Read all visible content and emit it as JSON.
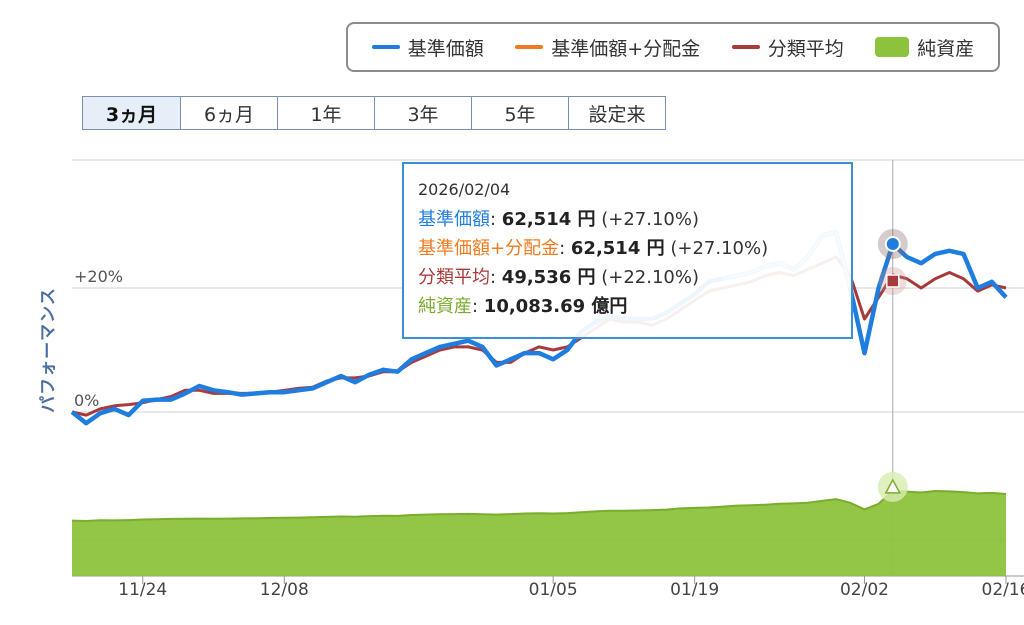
{
  "legend": {
    "items": [
      {
        "label": "基準価額",
        "color": "#1f7de0",
        "kind": "line"
      },
      {
        "label": "基準価額+分配金",
        "color": "#f07a1f",
        "kind": "line"
      },
      {
        "label": "分類平均",
        "color": "#a83a3a",
        "kind": "line"
      },
      {
        "label": "純資産",
        "color": "#8dc23c",
        "kind": "area"
      }
    ]
  },
  "range_buttons": [
    {
      "label": "3ヵ月",
      "active": true
    },
    {
      "label": "6ヵ月",
      "active": false
    },
    {
      "label": "1年",
      "active": false
    },
    {
      "label": "3年",
      "active": false
    },
    {
      "label": "5年",
      "active": false
    },
    {
      "label": "設定来",
      "active": false
    }
  ],
  "tooltip": {
    "date": "2026/02/04",
    "rows": [
      {
        "label": "基準価額",
        "value": "62,514 円",
        "change": "(+27.10%)",
        "color": "#1f7de0"
      },
      {
        "label": "基準価額+分配金",
        "value": "62,514 円",
        "change": "(+27.10%)",
        "color": "#f07a1f"
      },
      {
        "label": "分類平均",
        "value": "49,536 円",
        "change": "(+22.10%)",
        "color": "#a83a3a"
      },
      {
        "label": "純資産",
        "value": "10,083.69 億円",
        "change": "",
        "color": "#7aab2c"
      }
    ]
  },
  "chart_data": {
    "type": "line",
    "ylabel": "パフォーマンス",
    "y_tick_labels": [
      "0%",
      "+20%"
    ],
    "y_ticks": [
      0,
      20
    ],
    "ylim": [
      -8,
      30
    ],
    "x_tick_labels": [
      "11/24",
      "12/08",
      "01/05",
      "01/19",
      "02/02",
      "02/16"
    ],
    "x_tick_index": [
      5,
      15,
      34,
      44,
      56,
      66
    ],
    "grid": true,
    "legend_position": "top-right",
    "highlight_index": 58,
    "x_count": 67,
    "series": [
      {
        "name": "基準価額",
        "color": "#1f7de0",
        "values": [
          0.0,
          -1.8,
          -0.2,
          0.5,
          -0.5,
          1.8,
          2.0,
          2.0,
          3.0,
          4.2,
          3.5,
          3.2,
          2.8,
          3.0,
          3.2,
          3.2,
          3.5,
          3.8,
          4.8,
          5.8,
          4.8,
          6.0,
          6.8,
          6.5,
          8.5,
          9.5,
          10.5,
          11.0,
          11.5,
          10.5,
          7.5,
          8.5,
          9.5,
          9.5,
          8.5,
          10.0,
          13.0,
          14.5,
          15.5,
          15.0,
          15.0,
          15.0,
          16.0,
          17.5,
          19.0,
          21.0,
          21.5,
          22.0,
          22.5,
          23.5,
          24.0,
          23.0,
          25.0,
          28.5,
          29.0,
          20.0,
          9.5,
          20.0,
          27.1,
          25.0,
          24.0,
          25.5,
          26.0,
          25.5,
          20.0,
          21.0,
          18.5
        ],
        "dashed_from_index": 46
      },
      {
        "name": "基準価額+分配金",
        "color": "#f07a1f",
        "values": [
          0.0,
          -1.8,
          -0.2,
          0.5,
          -0.5,
          1.8,
          2.0,
          2.0,
          3.0,
          4.2,
          3.5,
          3.2,
          2.8,
          3.0,
          3.2,
          3.2,
          3.5,
          3.8,
          4.8,
          5.8,
          4.8,
          6.0,
          6.8,
          6.5,
          8.5,
          9.5,
          10.5,
          11.0,
          11.5,
          10.5,
          7.5,
          8.5,
          9.5,
          9.5,
          8.5,
          10.0,
          13.0,
          14.5,
          15.5,
          15.0,
          15.0,
          15.0,
          16.0,
          17.5,
          19.0,
          21.0,
          21.5,
          22.0,
          22.5,
          23.5,
          24.0,
          23.0,
          25.0,
          28.5,
          29.0,
          20.0,
          9.5,
          20.0,
          27.1,
          25.0,
          24.0,
          25.5,
          26.0,
          25.5,
          20.0,
          21.0,
          18.5
        ]
      },
      {
        "name": "分類平均",
        "color": "#a83a3a",
        "values": [
          0.0,
          -0.5,
          0.5,
          1.0,
          1.2,
          1.5,
          2.0,
          2.5,
          3.5,
          3.5,
          3.0,
          3.0,
          3.0,
          3.0,
          3.2,
          3.5,
          3.8,
          4.0,
          5.0,
          5.5,
          5.5,
          5.8,
          6.5,
          6.5,
          8.0,
          9.0,
          10.0,
          10.5,
          10.5,
          10.0,
          8.0,
          8.0,
          9.5,
          10.5,
          10.0,
          10.5,
          12.0,
          13.5,
          15.0,
          14.5,
          14.5,
          14.0,
          15.0,
          16.5,
          18.0,
          19.5,
          20.0,
          20.5,
          21.0,
          22.0,
          22.5,
          22.0,
          23.0,
          24.0,
          25.0,
          22.0,
          15.0,
          18.5,
          22.1,
          21.5,
          20.0,
          21.5,
          22.5,
          21.5,
          19.5,
          20.5,
          20.0
        ]
      },
      {
        "name": "純資産",
        "color": "#8dc23c",
        "axis_note": "plotted on separate scale below",
        "values": [
          8500,
          8480,
          8520,
          8510,
          8530,
          8560,
          8570,
          8590,
          8600,
          8610,
          8600,
          8610,
          8620,
          8630,
          8640,
          8650,
          8660,
          8680,
          8700,
          8720,
          8710,
          8740,
          8760,
          8750,
          8800,
          8820,
          8840,
          8850,
          8860,
          8840,
          8820,
          8850,
          8880,
          8890,
          8880,
          8900,
          8950,
          8990,
          9030,
          9030,
          9040,
          9060,
          9090,
          9150,
          9180,
          9200,
          9250,
          9300,
          9320,
          9350,
          9400,
          9420,
          9450,
          9550,
          9650,
          9450,
          9100,
          9400,
          10083.69,
          10050,
          10000,
          10080,
          10060,
          10020,
          9950,
          9980,
          9920
        ]
      }
    ]
  }
}
